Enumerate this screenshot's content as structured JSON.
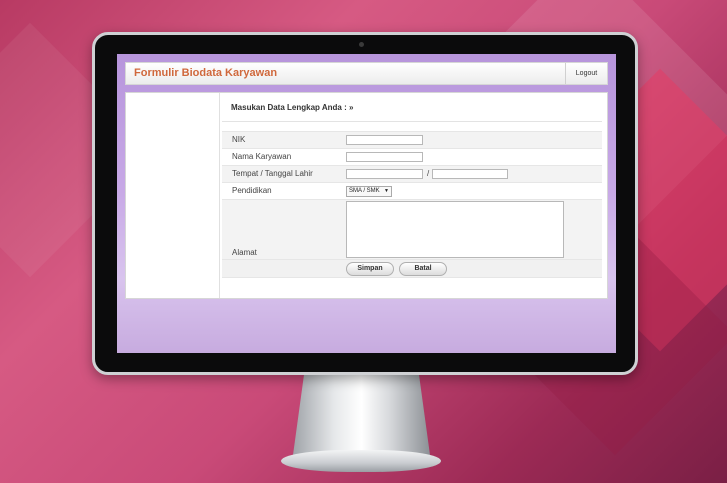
{
  "app": {
    "title": "Formulir Biodata Karyawan",
    "logout_label": "Logout",
    "brand_color": "#d0683c"
  },
  "form": {
    "heading": "Masukan Data Lengkap Anda : »",
    "fields": {
      "nik": {
        "label": "NIK",
        "value": ""
      },
      "nama": {
        "label": "Nama Karyawan",
        "value": ""
      },
      "ttl": {
        "label": "Tempat / Tanggal Lahir",
        "separator": "/",
        "place_value": "",
        "date_value": ""
      },
      "pendidikan": {
        "label": "Pendidikan",
        "selected": "SMA / SMK"
      },
      "alamat": {
        "label": "Alamat",
        "value": ""
      }
    },
    "buttons": {
      "save_label": "Simpan",
      "cancel_label": "Batal"
    }
  },
  "icons": {
    "select_arrow": "chevron-down-icon"
  }
}
